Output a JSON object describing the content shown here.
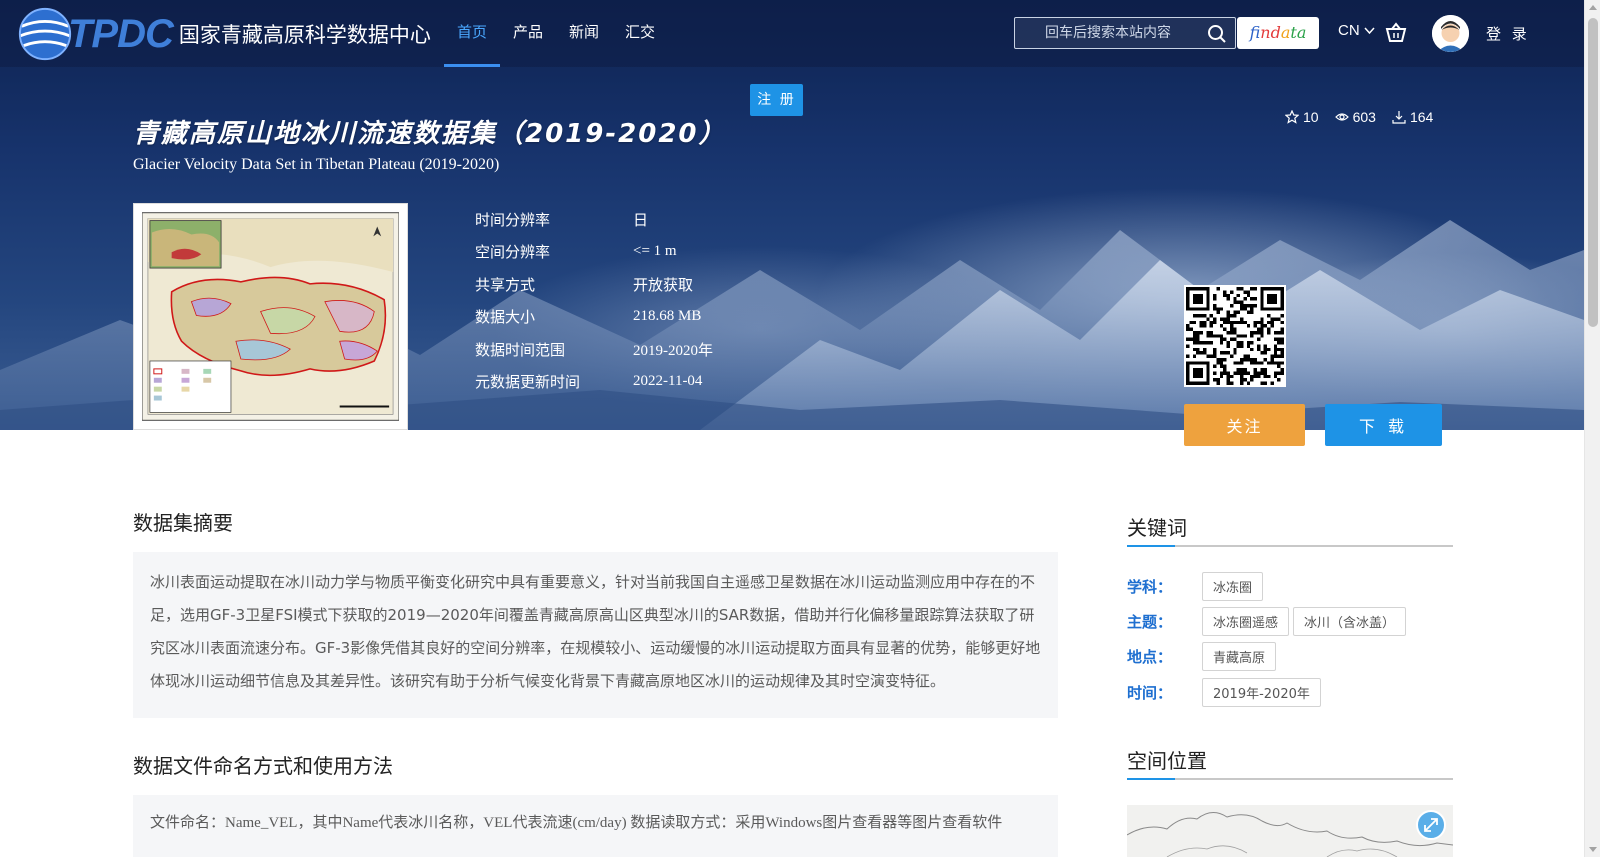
{
  "header": {
    "logo_text": "TPDC",
    "logo_cn": "国家青藏高原科学数据中心",
    "nav": [
      {
        "label": "首页",
        "active": true
      },
      {
        "label": "产品"
      },
      {
        "label": "新闻"
      },
      {
        "label": "汇交"
      }
    ],
    "search_placeholder": "回车后搜索本站内容",
    "findata": {
      "p1": "f",
      "p2": "ind",
      "p3": "a",
      "p4": "ta"
    },
    "lang": "CN",
    "login": "登 录"
  },
  "register_label": "注 册",
  "dataset": {
    "title_cn": "青藏高原山地冰川流速数据集（2019-2020）",
    "title_en": "Glacier Velocity Data Set in Tibetan Plateau (2019-2020)",
    "stats": {
      "stars": "10",
      "views": "603",
      "downloads": "164"
    },
    "meta": [
      {
        "label": "时间分辨率",
        "value": "日"
      },
      {
        "label": "空间分辨率",
        "value": "<= 1 m"
      },
      {
        "label": "共享方式",
        "value": "开放获取"
      },
      {
        "label": "数据大小",
        "value": "218.68 MB"
      },
      {
        "label": "数据时间范围",
        "value": "2019-2020年"
      },
      {
        "label": "元数据更新时间",
        "value": "2022-11-04"
      }
    ],
    "follow_label": "关注",
    "download_label": "下 载"
  },
  "abstract": {
    "title": "数据集摘要",
    "text": "冰川表面运动提取在冰川动力学与物质平衡变化研究中具有重要意义，针对当前我国自主遥感卫星数据在冰川运动监测应用中存在的不足，选用GF-3卫星FSI模式下获取的2019—2020年间覆盖青藏高原高山区典型冰川的SAR数据，借助并行化偏移量跟踪算法获取了研究区冰川表面流速分布。GF-3影像凭借其良好的空间分辨率，在规模较小、运动缓慢的冰川运动提取方面具有显著的优势，能够更好地体现冰川运动细节信息及其差异性。该研究有助于分析气候变化背景下青藏高原地区冰川的运动规律及其时空演变特征。"
  },
  "usage": {
    "title": "数据文件命名方式和使用方法",
    "text": "文件命名：Name_VEL，其中Name代表冰川名称，VEL代表流速(cm/day) 数据读取方式：采用Windows图片查看器等图片查看软件"
  },
  "keywords": {
    "title": "关键词",
    "rows": [
      {
        "label": "学科：",
        "tags": [
          "冰冻圈"
        ]
      },
      {
        "label": "主题：",
        "tags": [
          "冰冻圈遥感",
          "冰川（含冰盖）"
        ]
      },
      {
        "label": "地点：",
        "tags": [
          "青藏高原"
        ]
      },
      {
        "label": "时间：",
        "tags": [
          "2019年-2020年"
        ]
      }
    ]
  },
  "spatial": {
    "title": "空间位置"
  }
}
